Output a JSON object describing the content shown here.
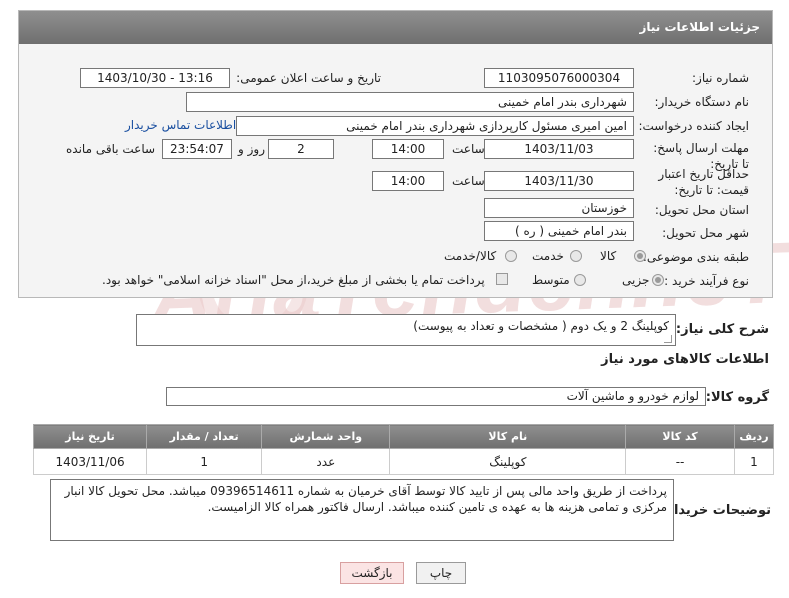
{
  "panel": {
    "title": "جزئیات اطلاعات نیاز"
  },
  "fields": {
    "need_number_label": "شماره نیاز:",
    "need_number": "1103095076000304",
    "announce_label": "تاریخ و ساعت اعلان عمومی:",
    "announce_value": "1403/10/30 - 13:16",
    "buyer_org_label": "نام دستگاه خریدار:",
    "buyer_org": "شهرداری بندر امام خمینی",
    "requester_label": "ایجاد کننده درخواست:",
    "requester": "امین امیری مسئول کارپردازی شهرداری بندر امام خمینی",
    "contact_link": "اطلاعات تماس خریدار",
    "deadline_label": "مهلت ارسال پاسخ: تا تاریخ:",
    "deadline_date": "1403/11/03",
    "time_label": "ساعت",
    "deadline_time": "14:00",
    "days_value": "2",
    "days_label": "روز و",
    "remaining_time": "23:54:07",
    "remaining_label": "ساعت باقی مانده",
    "validity_label": "حداقل تاریخ اعتبار قیمت: تا تاریخ:",
    "validity_date": "1403/11/30",
    "validity_time": "14:00",
    "province_label": "استان محل تحویل:",
    "province": "خوزستان",
    "city_label": "شهر محل تحویل:",
    "city": "بندر امام خمینی ( ره )",
    "category_label": "طبقه بندی موضوعی:",
    "category_options": [
      "کالا",
      "خدمت",
      "کالا/خدمت"
    ],
    "process_label": "نوع فرآیند خرید :",
    "process_options": [
      "جزیی",
      "متوسط"
    ],
    "payment_note": "پرداخت تمام یا بخشی از مبلغ خرید،از محل \"اسناد خزانه اسلامی\" خواهد بود."
  },
  "description": {
    "label": "شرح کلی نیاز:",
    "value": "کوپلینگ 2 و یک دوم ( مشخصات و تعداد به پیوست)"
  },
  "goods_section": {
    "title": "اطلاعات کالاهای مورد نیاز"
  },
  "goods_group": {
    "label": "گروه کالا:",
    "value": "لوازم خودرو و ماشین آلات"
  },
  "table": {
    "headers": [
      "ردیف",
      "کد کالا",
      "نام کالا",
      "واحد شمارش",
      "تعداد / مقدار",
      "تاریخ نیاز"
    ],
    "rows": [
      [
        "1",
        "--",
        "کوپلینگ",
        "عدد",
        "1",
        "1403/11/06"
      ]
    ]
  },
  "buyer_notes": {
    "label": "توضیحات خریدار:",
    "value": "پرداخت از طریق واحد مالی پس از تایید کالا توسط آقای خرمیان به شماره 09396514611  میباشد. محل تحویل کالا انبار مرکزی و تمامی هزینه ها به عهده ی تامین کننده میباشد. ارسال فاکتور همراه کالا الزامیست."
  },
  "buttons": {
    "print": "چاپ",
    "back": "بازگشت"
  },
  "watermark": "AriaTender.neT"
}
